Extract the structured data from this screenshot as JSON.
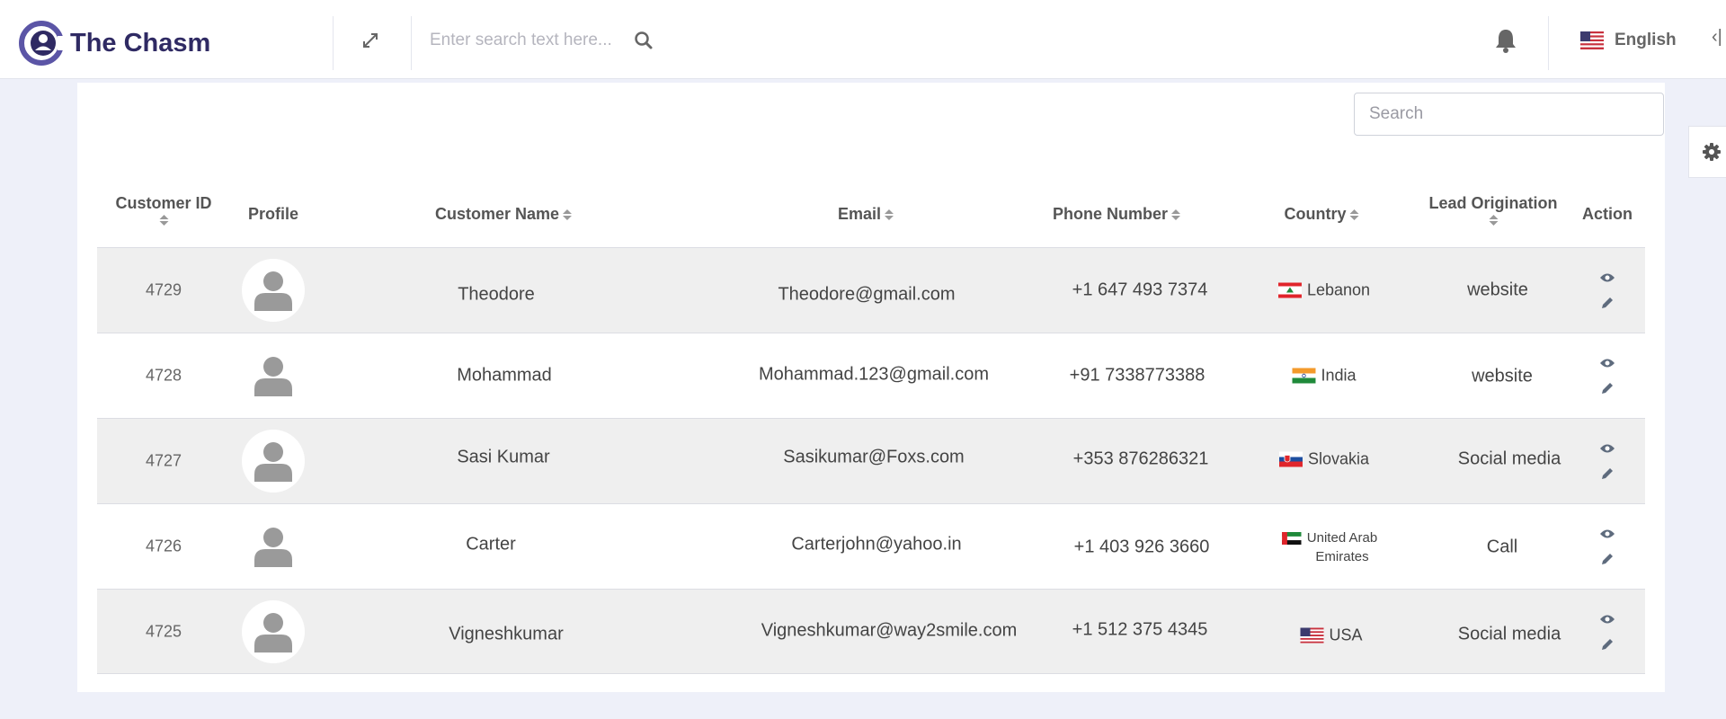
{
  "header": {
    "brand": "The Chasm",
    "search_placeholder": "Enter search text here...",
    "language": "English"
  },
  "table": {
    "search_placeholder": "Search",
    "columns": [
      "Customer ID",
      "Profile",
      "Customer Name",
      "Email",
      "Phone Number",
      "Country",
      "Lead Origination",
      "Action"
    ],
    "rows": [
      {
        "id": "4729",
        "name": "Theodore",
        "email": "Theodore@gmail.com",
        "phone": "+1 647 493 7374",
        "country": "Lebanon",
        "flag": "lebanon-flag",
        "lead": "website"
      },
      {
        "id": "4728",
        "name": "Mohammad",
        "email": "Mohammad.123@gmail.com",
        "phone": "+91 7338773388",
        "country": "India",
        "flag": "india-flag",
        "lead": "website"
      },
      {
        "id": "4727",
        "name": "Sasi Kumar",
        "email": "Sasikumar@Foxs.com",
        "phone": "+353 876286321",
        "country": "Slovakia",
        "flag": "slovakia-flag",
        "lead": "Social media"
      },
      {
        "id": "4726",
        "name": "Carter",
        "email": "Carterjohn@yahoo.in",
        "phone": "+1 403 926 3660",
        "country_line1": "United Arab",
        "country_line2": "Emirates",
        "flag": "uae-flag",
        "lead": "Call"
      },
      {
        "id": "4725",
        "name": "Vigneshkumar",
        "email": "Vigneshkumar@way2smile.com",
        "phone": "+1 512 375 4345",
        "country": "USA",
        "flag": "usa-flag",
        "lead": "Social media"
      }
    ]
  },
  "colors": {
    "brand": "#2f2a63",
    "logo": "#5b55a6",
    "page_background": "#eef0f9",
    "row_shade": "#efefef",
    "action_icon": "#5e6b7d"
  }
}
